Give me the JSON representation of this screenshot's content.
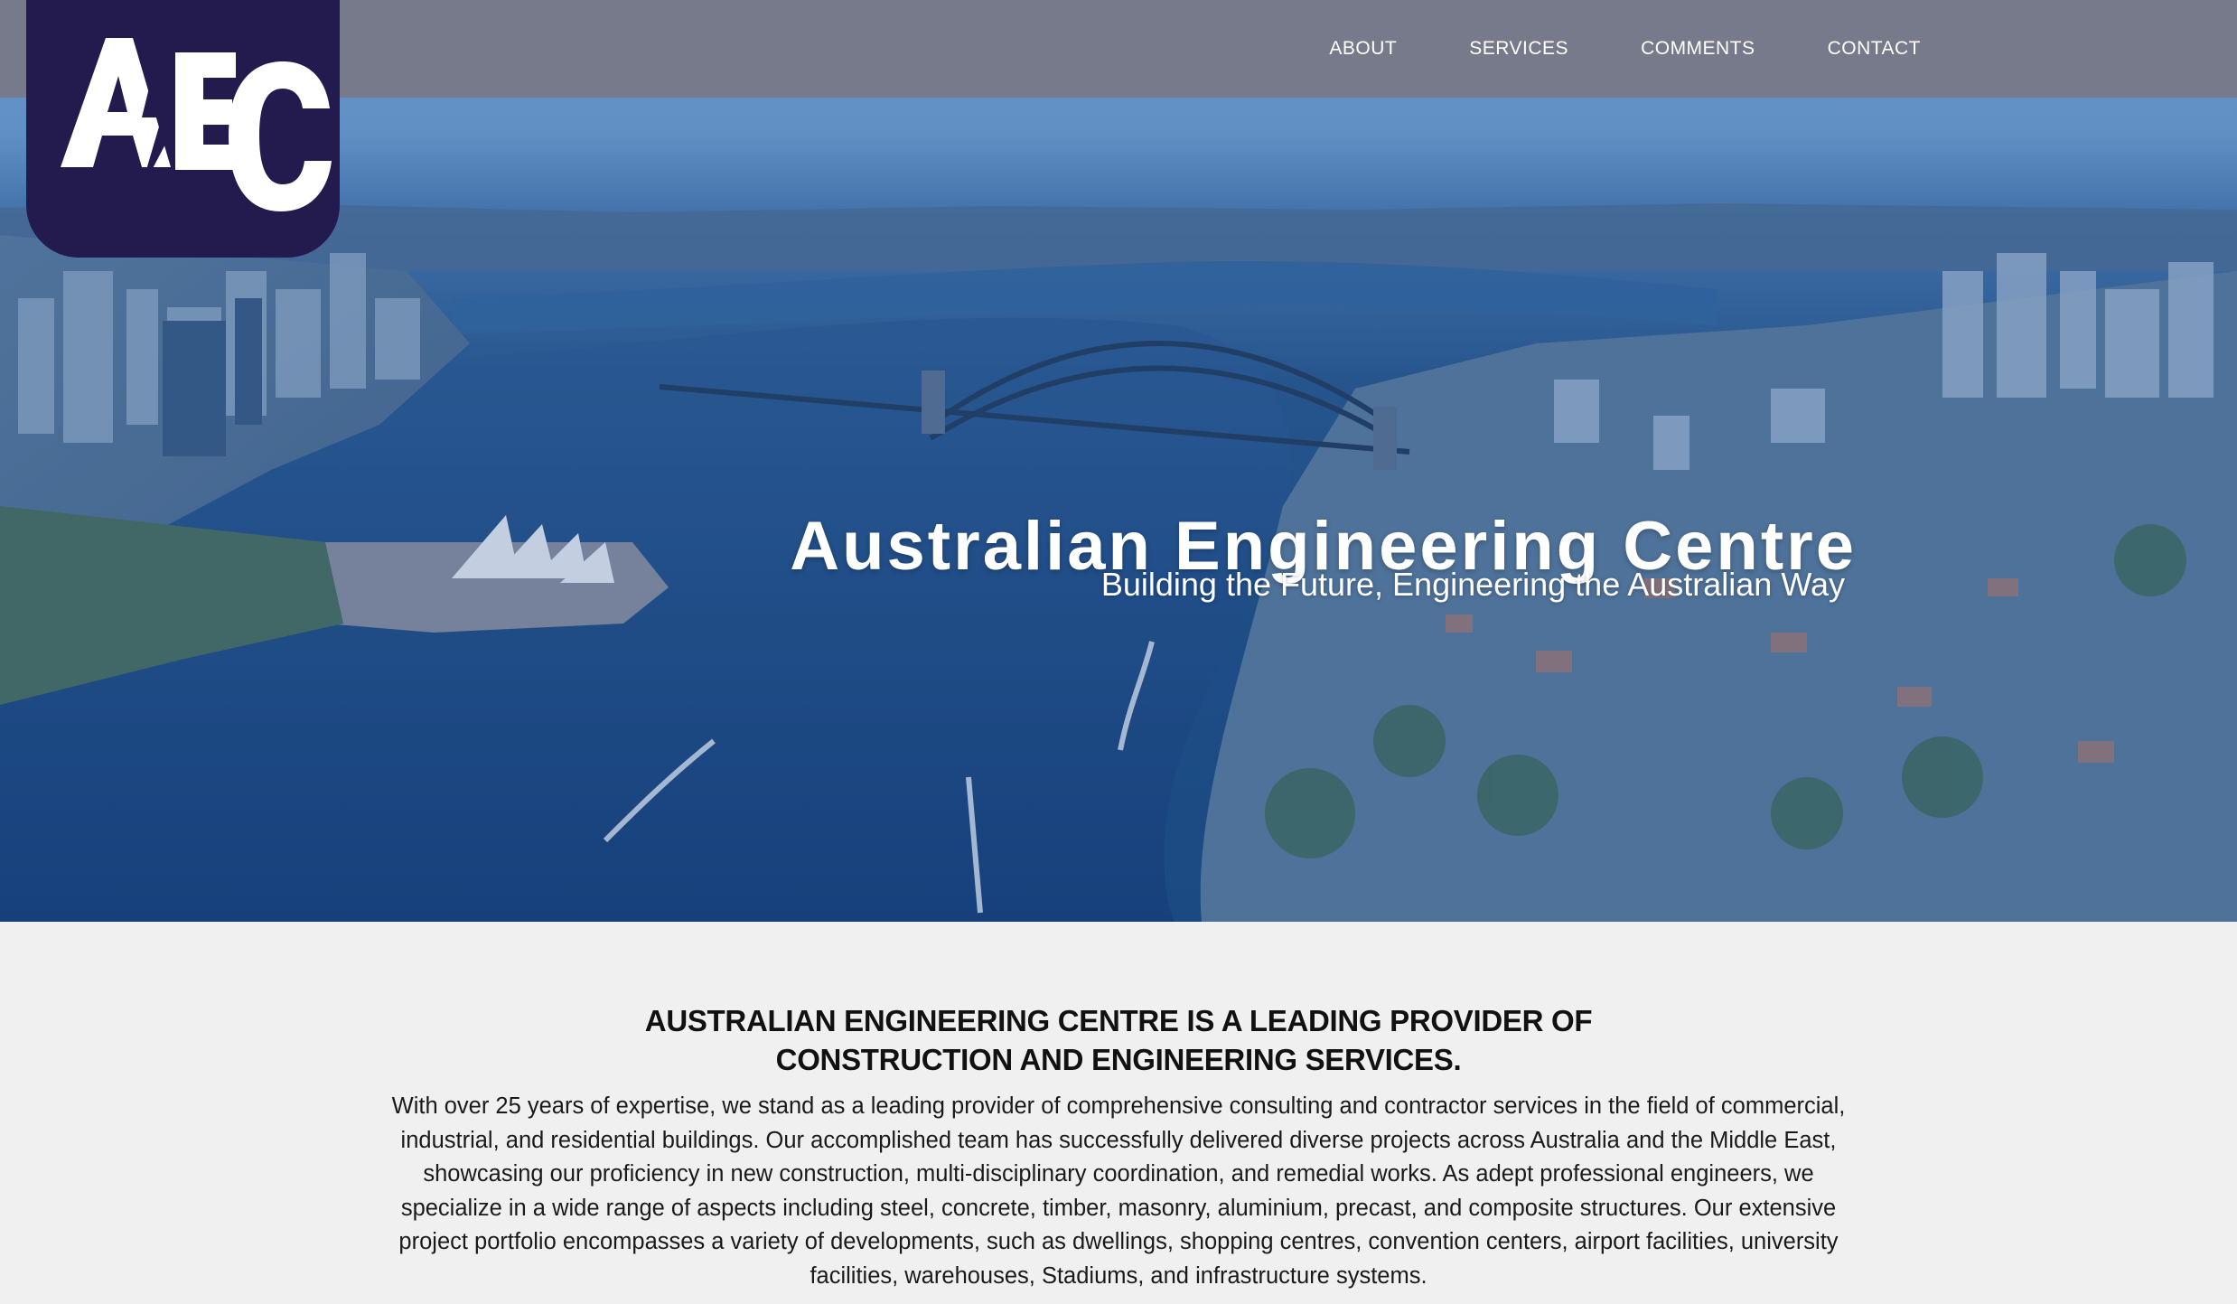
{
  "brand": {
    "logo_text": "AEC",
    "logo_color": "#231a4e"
  },
  "nav": {
    "items": [
      {
        "label": "ABOUT"
      },
      {
        "label": "SERVICES"
      },
      {
        "label": "COMMENTS"
      },
      {
        "label": "CONTACT"
      }
    ],
    "bar_color": "#777a8a"
  },
  "hero": {
    "title": "Australian Engineering Centre",
    "subtitle": "Building the Future, Engineering the Australian Way",
    "image_subject": "aerial-view-sydney-harbour"
  },
  "intro": {
    "heading_line1": "AUSTRALIAN ENGINEERING CENTRE IS A LEADING PROVIDER OF",
    "heading_line2": "CONSTRUCTION AND ENGINEERING SERVICES.",
    "body": "With over 25 years of expertise, we stand as a leading provider of comprehensive consulting and contractor services in the field of commercial, industrial, and residential buildings. Our accomplished team has successfully delivered diverse projects across Australia and the Middle East, showcasing our proficiency in new construction, multi-disciplinary coordination, and remedial works. As adept professional engineers, we specialize in a wide range of aspects including steel, concrete, timber, masonry, aluminium, precast, and composite structures. Our extensive project portfolio encompasses a variety of developments, such as dwellings, shopping centres, convention centers, airport facilities, university facilities, warehouses, Stadiums, and infrastructure systems."
  }
}
